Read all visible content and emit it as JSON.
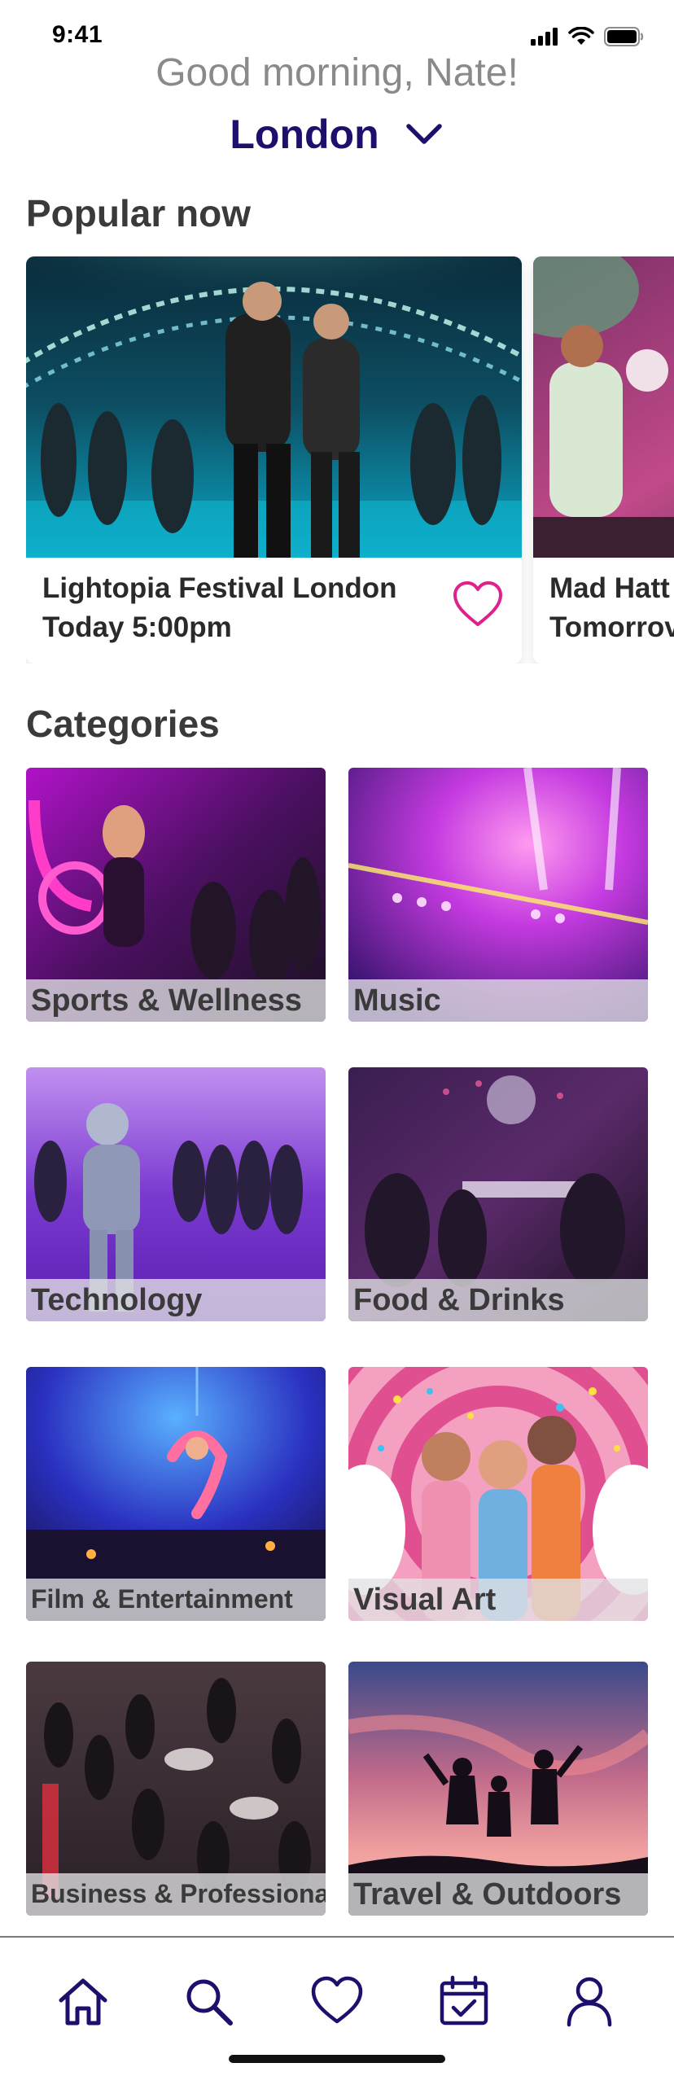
{
  "status_bar": {
    "time": "9:41"
  },
  "header": {
    "greeting": "Good morning, Nate!",
    "location": "London"
  },
  "popular": {
    "title": "Popular now",
    "events": [
      {
        "title": "Lightopia Festival London",
        "time": "Today 5:00pm"
      },
      {
        "title": "Mad Hatt",
        "time": "Tomorrov"
      }
    ]
  },
  "categories": {
    "title": "Categories",
    "items": [
      {
        "label": "Sports & Wellness"
      },
      {
        "label": "Music"
      },
      {
        "label": "Technology"
      },
      {
        "label": "Food & Drinks"
      },
      {
        "label": "Film & Entertainment"
      },
      {
        "label": "Visual Art"
      },
      {
        "label": "Business & Professional"
      },
      {
        "label": "Travel & Outdoors"
      }
    ]
  },
  "tab_bar": {
    "tabs": [
      {
        "icon": "home-icon"
      },
      {
        "icon": "search-icon"
      },
      {
        "icon": "heart-icon"
      },
      {
        "icon": "calendar-check-icon"
      },
      {
        "icon": "profile-icon"
      }
    ]
  },
  "colors": {
    "accent": "#1d0f6b",
    "heart": "#e0208c",
    "greeting": "#8a8a8a"
  }
}
